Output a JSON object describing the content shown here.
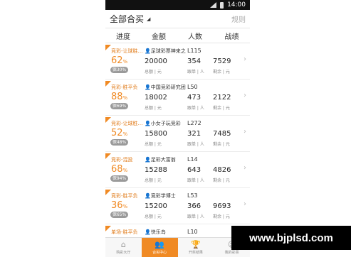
{
  "statusbar": {
    "time": "14:00"
  },
  "header": {
    "title": "全部合买",
    "rules": "规则"
  },
  "columns": [
    "进度",
    "金额",
    "人数",
    "战绩"
  ],
  "rows": [
    {
      "type": "竞彩-让球胜…",
      "owner": "足球彩票神来之…",
      "level": "L115",
      "progress": "62",
      "progress_unit": "%",
      "bao": "保30%",
      "amount": "20000",
      "amount_label": "总额 | 元",
      "count": "354",
      "count_label": "跟单 | 人",
      "record": "7529",
      "record_label": "剩余 | 元"
    },
    {
      "type": "竞彩-胜平负",
      "owner": "中国竞彩研究团…",
      "level": "L50",
      "progress": "88",
      "progress_unit": "%",
      "bao": "保69%",
      "amount": "18002",
      "amount_label": "总额 | 元",
      "count": "473",
      "count_label": "跟单 | 人",
      "record": "2122",
      "record_label": "剩余 | 元"
    },
    {
      "type": "竞彩-让球胜…",
      "owner": "小女子玩竞彩",
      "level": "L272",
      "progress": "52",
      "progress_unit": "%",
      "bao": "保48%",
      "amount": "15800",
      "amount_label": "总额 | 元",
      "count": "321",
      "count_label": "跟单 | 人",
      "record": "7485",
      "record_label": "剩余 | 元"
    },
    {
      "type": "竞彩-混投",
      "owner": "足彩大富翁",
      "level": "L14",
      "progress": "68",
      "progress_unit": "%",
      "bao": "保94%",
      "amount": "15288",
      "amount_label": "总额 | 元",
      "count": "643",
      "count_label": "跟单 | 人",
      "record": "4826",
      "record_label": "剩余 | 元"
    },
    {
      "type": "竞彩-胜平负",
      "owner": "竞彩学博士",
      "level": "L53",
      "progress": "36",
      "progress_unit": "%",
      "bao": "保65%",
      "amount": "15200",
      "amount_label": "总额 | 元",
      "count": "366",
      "count_label": "跟单 | 人",
      "record": "9693",
      "record_label": "剩余 | 元"
    },
    {
      "type": "单场-胜平负",
      "owner": "快乐岛",
      "level": "L10",
      "progress": "",
      "progress_unit": "",
      "bao": "",
      "amount": "",
      "amount_label": "",
      "count": "",
      "count_label": "",
      "record": "",
      "record_label": ""
    }
  ],
  "tabs": [
    {
      "label": "购彩大厅",
      "icon": "home-icon",
      "glyph": "⌂"
    },
    {
      "label": "合买中心",
      "icon": "people-icon",
      "glyph": "👥"
    },
    {
      "label": "开奖结果",
      "icon": "trophy-icon",
      "glyph": "🏆"
    },
    {
      "label": "我的彩票",
      "icon": "user-icon",
      "glyph": "☺"
    }
  ],
  "watermark": "www.bjplsd.com",
  "colors": {
    "accent": "#f08a24",
    "badge": "#9a9a9a"
  }
}
